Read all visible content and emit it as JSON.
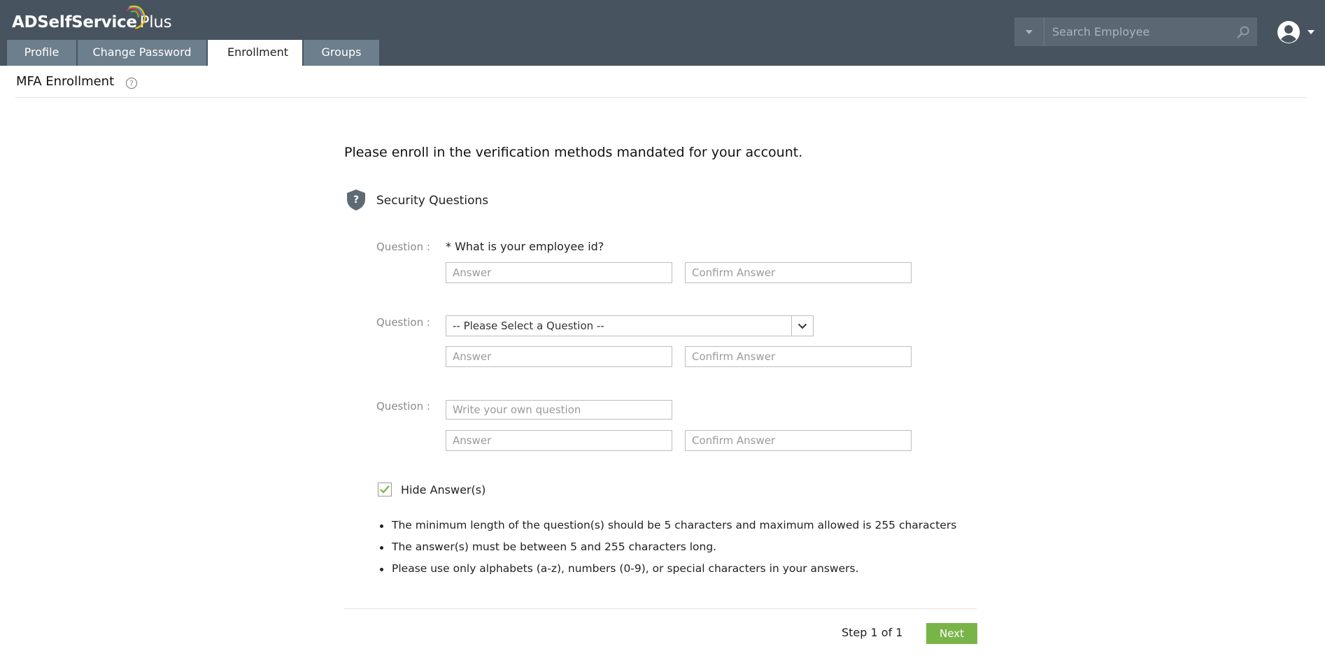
{
  "app": {
    "logo_main": "ADSelfService",
    "logo_suffix": "Plus"
  },
  "tabs": [
    {
      "label": "Profile"
    },
    {
      "label": "Change Password"
    },
    {
      "label": "Enrollment",
      "active": true
    },
    {
      "label": "Groups"
    }
  ],
  "search": {
    "placeholder": "Search Employee",
    "dropdown_icon": "caret-down-icon",
    "search_icon": "search-icon"
  },
  "user_menu": {
    "icon": "user-avatar-icon",
    "caret_icon": "caret-down-icon"
  },
  "page": {
    "title": "MFA Enrollment",
    "help_icon": "help-circle-icon"
  },
  "enrollment": {
    "intro": "Please enroll in the verification methods mandated for your account.",
    "section_title": "Security Questions",
    "section_icon": "shield-question-icon",
    "question_label": "Question :",
    "questions": [
      {
        "text": "* What is your employee id?",
        "answer_placeholder": "Answer",
        "confirm_placeholder": "Confirm Answer"
      },
      {
        "selected": "-- Please Select a Question --",
        "answer_placeholder": "Answer",
        "confirm_placeholder": "Confirm Answer"
      },
      {
        "own_placeholder": "Write your own question",
        "answer_placeholder": "Answer",
        "confirm_placeholder": "Confirm Answer"
      }
    ],
    "hide_answers_label": "Hide Answer(s)",
    "hide_answers_checked": true,
    "notes": [
      "The minimum length of the question(s) should be 5 characters and maximum allowed is 255 characters",
      "The answer(s) must be between 5 and 255 characters long.",
      "Please use only alphabets (a-z), numbers (0-9), or special characters in your answers."
    ]
  },
  "footer": {
    "step": "Step 1 of 1",
    "next_label": "Next"
  },
  "colors": {
    "header_bg": "#47545f",
    "tab_bg": "#6d7e8c",
    "next_button": "#79b449"
  }
}
